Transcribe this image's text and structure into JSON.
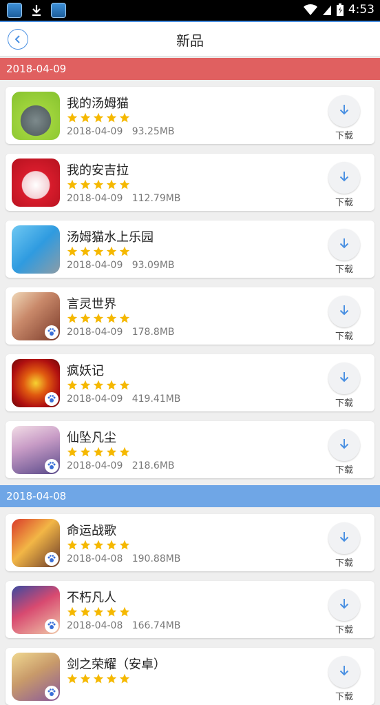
{
  "status_bar": {
    "time": "4:53"
  },
  "header": {
    "title": "新品",
    "back_icon": "chevron-left-icon"
  },
  "colors": {
    "accent": "#4a90e2",
    "section_red": "#e06060",
    "section_blue": "#6fa6e6",
    "star": "#f5b800"
  },
  "sections": [
    {
      "date": "2018-04-09",
      "apps": [
        {
          "name": "我的汤姆猫",
          "rating": 5,
          "date": "2018-04-09",
          "size": "93.25MB",
          "download_label": "下载"
        },
        {
          "name": "我的安吉拉",
          "rating": 5,
          "date": "2018-04-09",
          "size": "112.79MB",
          "download_label": "下载"
        },
        {
          "name": "汤姆猫水上乐园",
          "rating": 5,
          "date": "2018-04-09",
          "size": "93.09MB",
          "download_label": "下载"
        },
        {
          "name": "言灵世界",
          "rating": 5,
          "date": "2018-04-09",
          "size": "178.8MB",
          "download_label": "下载"
        },
        {
          "name": "疯妖记",
          "rating": 5,
          "date": "2018-04-09",
          "size": "419.41MB",
          "download_label": "下载"
        },
        {
          "name": "仙坠凡尘",
          "rating": 5,
          "date": "2018-04-09",
          "size": "218.6MB",
          "download_label": "下载"
        }
      ]
    },
    {
      "date": "2018-04-08",
      "apps": [
        {
          "name": "命运战歌",
          "rating": 5,
          "date": "2018-04-08",
          "size": "190.88MB",
          "download_label": "下载"
        },
        {
          "name": "不朽凡人",
          "rating": 5,
          "date": "2018-04-08",
          "size": "166.74MB",
          "download_label": "下载"
        },
        {
          "name": "剑之荣耀（安卓）",
          "rating": 5,
          "date": "",
          "size": "",
          "download_label": "下载"
        }
      ]
    }
  ]
}
